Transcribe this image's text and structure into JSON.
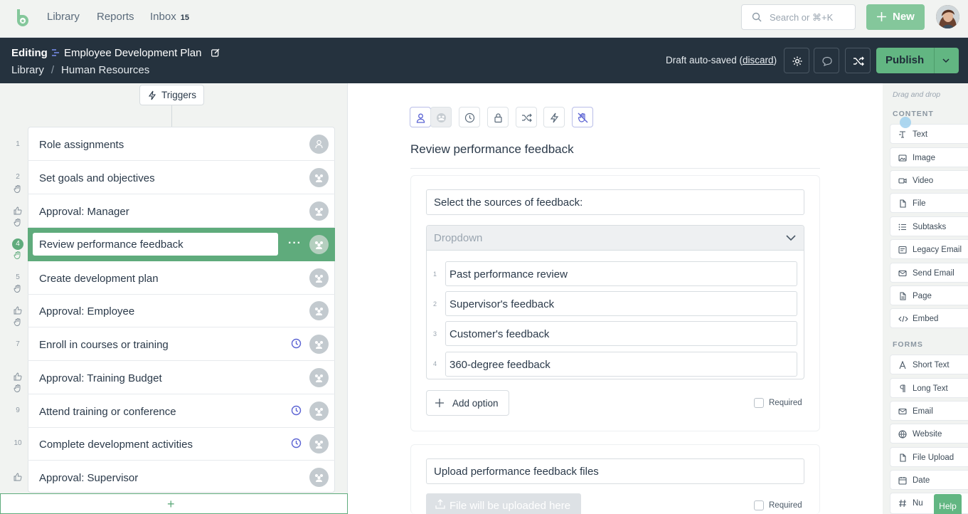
{
  "topbar": {
    "nav": [
      {
        "label": "Library"
      },
      {
        "label": "Reports"
      },
      {
        "label": "Inbox",
        "count": "15"
      }
    ],
    "search_placeholder": "Search or ⌘+K",
    "new_label": "New"
  },
  "editbar": {
    "mode": "Editing",
    "title": "Employee Development Plan",
    "breadcrumb": [
      "Library",
      "Human Resources"
    ],
    "draft_text": "Draft auto-saved (",
    "discard_label": "discard",
    "draft_close": ")",
    "publish_label": "Publish"
  },
  "left": {
    "triggers_label": "Triggers",
    "tasks": [
      {
        "num": "1",
        "label": "Role assignments",
        "selected": false
      },
      {
        "num": "2",
        "label": "Set goals and objectives",
        "selected": false
      },
      {
        "num": "",
        "label": "Approval: Manager",
        "selected": false
      },
      {
        "num": "4",
        "label": "Review performance feedback",
        "selected": true
      },
      {
        "num": "5",
        "label": "Create development plan",
        "selected": false
      },
      {
        "num": "",
        "label": "Approval: Employee",
        "selected": false
      },
      {
        "num": "7",
        "label": "Enroll in courses or training",
        "selected": false
      },
      {
        "num": "",
        "label": "Approval: Training Budget",
        "selected": false
      },
      {
        "num": "9",
        "label": "Attend training or conference",
        "selected": false
      },
      {
        "num": "10",
        "label": "Complete development activities",
        "selected": false
      },
      {
        "num": "",
        "label": "Approval: Supervisor",
        "selected": false
      }
    ],
    "add_label": "+"
  },
  "main": {
    "task_title": "Review performance feedback",
    "question": "Select the sources of feedback:",
    "dropdown_placeholder": "Dropdown",
    "options": [
      {
        "num": "1",
        "label": "Past performance review"
      },
      {
        "num": "2",
        "label": "Supervisor's feedback"
      },
      {
        "num": "3",
        "label": "Customer's feedback"
      },
      {
        "num": "4",
        "label": "360-degree feedback"
      }
    ],
    "add_option_label": "Add option",
    "required_label": "Required",
    "upload_title": "Upload performance feedback files",
    "upload_placeholder": "File will be uploaded here"
  },
  "right": {
    "drag_hint": "Drag and drop",
    "content_heading": "CONTENT",
    "content_items": [
      {
        "label": "Text",
        "icon": "text-icon"
      },
      {
        "label": "Image",
        "icon": "image-icon"
      },
      {
        "label": "Video",
        "icon": "video-icon"
      },
      {
        "label": "File",
        "icon": "file-icon"
      },
      {
        "label": "Subtasks",
        "icon": "subtasks-icon"
      },
      {
        "label": "Legacy Email",
        "icon": "legacy-email-icon"
      },
      {
        "label": "Send Email",
        "icon": "send-email-icon"
      },
      {
        "label": "Page",
        "icon": "page-icon"
      },
      {
        "label": "Embed",
        "icon": "embed-icon"
      }
    ],
    "forms_heading": "FORMS",
    "form_items": [
      {
        "label": "Short Text",
        "icon": "short-text-icon"
      },
      {
        "label": "Long Text",
        "icon": "long-text-icon"
      },
      {
        "label": "Email",
        "icon": "email-icon"
      },
      {
        "label": "Website",
        "icon": "website-icon"
      },
      {
        "label": "File Upload",
        "icon": "file-upload-icon"
      },
      {
        "label": "Date",
        "icon": "date-icon"
      },
      {
        "label": "Nu",
        "icon": "number-icon"
      }
    ],
    "help_label": "Help"
  },
  "colors": {
    "accent": "#62b682",
    "dark_header": "#25323e",
    "new_button": "#84c79b",
    "clock_icon": "#5b63d3"
  }
}
